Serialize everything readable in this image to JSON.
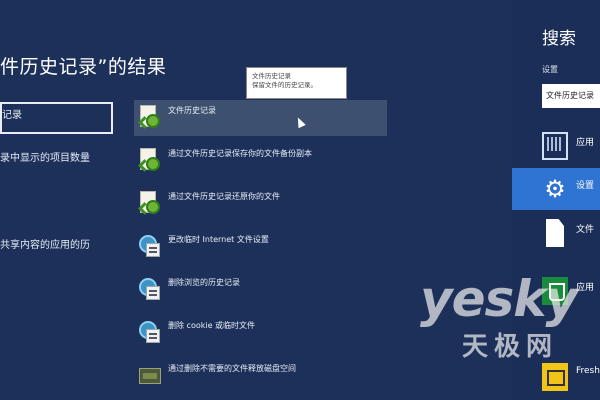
{
  "results": {
    "title": "件历史记录”的结果",
    "left_items": [
      {
        "label": "记录",
        "selected": true
      },
      {
        "label": "录中显示的项目数量"
      },
      {
        "label": "共享内容的应用的历"
      }
    ],
    "rows": [
      {
        "label": "文件历史记录",
        "icon": "file-history-icon",
        "hover": true
      },
      {
        "label": "通过文件历史记录保存你的文件备份副本",
        "icon": "file-history-icon"
      },
      {
        "label": "通过文件历史记录还原你的文件",
        "icon": "file-history-icon"
      },
      {
        "label": "更改临时 Internet 文件设置",
        "icon": "internet-options-icon"
      },
      {
        "label": "删除浏览的历史记录",
        "icon": "internet-options-icon"
      },
      {
        "label": "删除 cookie 或临时文件",
        "icon": "internet-options-icon"
      },
      {
        "label": "通过删除不需要的文件释放磁盘空间",
        "icon": "disk-cleanup-icon"
      }
    ],
    "tooltip": {
      "line1": "文件历史记录",
      "line2": "保留文件的历史记录。"
    }
  },
  "charm": {
    "title": "搜索",
    "scope_label": "设置",
    "search_value": "文件历史记录",
    "items": [
      {
        "label": "应用",
        "icon": "apps-icon"
      },
      {
        "label": "设置",
        "icon": "gear-icon",
        "active": true
      },
      {
        "label": "文件",
        "icon": "file-icon"
      },
      {
        "label": "应用",
        "icon": "store-icon"
      },
      {
        "label": "Fresh",
        "icon": "fresh-paint-icon"
      }
    ]
  },
  "watermark": {
    "latin": "yesky",
    "cjk": "天极网"
  },
  "colors": {
    "background": "#1c3059",
    "hover_row": "#3e506f",
    "active_charm": "#2f73d3"
  }
}
